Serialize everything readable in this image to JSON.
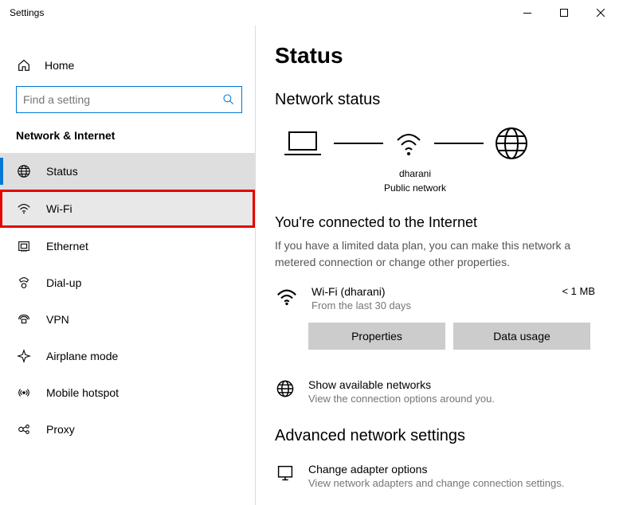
{
  "window": {
    "title": "Settings"
  },
  "sidebar": {
    "home": "Home",
    "search_placeholder": "Find a setting",
    "category": "Network & Internet",
    "items": [
      {
        "label": "Status"
      },
      {
        "label": "Wi-Fi"
      },
      {
        "label": "Ethernet"
      },
      {
        "label": "Dial-up"
      },
      {
        "label": "VPN"
      },
      {
        "label": "Airplane mode"
      },
      {
        "label": "Mobile hotspot"
      },
      {
        "label": "Proxy"
      }
    ]
  },
  "main": {
    "title": "Status",
    "network_status_title": "Network status",
    "diagram": {
      "network_name": "dharani",
      "network_type": "Public network"
    },
    "connected_title": "You're connected to the Internet",
    "connected_desc": "If you have a limited data plan, you can make this network a metered connection or change other properties.",
    "connection": {
      "name": "Wi-Fi (dharani)",
      "sub": "From the last 30 days",
      "usage": "< 1 MB"
    },
    "buttons": {
      "properties": "Properties",
      "data_usage": "Data usage"
    },
    "available": {
      "title": "Show available networks",
      "sub": "View the connection options around you."
    },
    "advanced_title": "Advanced network settings",
    "adapter": {
      "title": "Change adapter options",
      "sub": "View network adapters and change connection settings."
    }
  }
}
